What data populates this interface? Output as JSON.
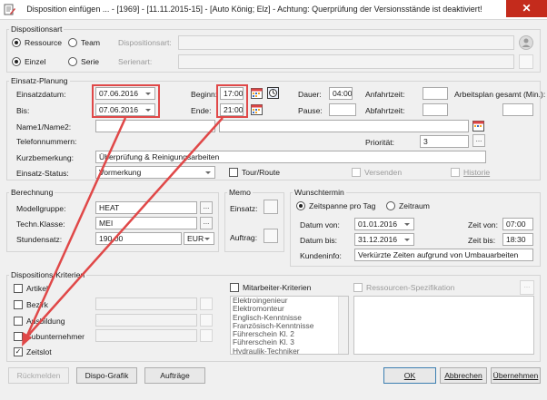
{
  "window": {
    "title": "Disposition einfügen ... - [1969] - [11.11.2015-15] - [Auto König; Elz] - Achtung: Querprüfung der Versionsstände ist deaktiviert!",
    "close_symbol": "✕"
  },
  "dispositionsart": {
    "group_label": "Dispositionsart",
    "ressource": "Ressource",
    "team": "Team",
    "einzel": "Einzel",
    "serie": "Serie",
    "dispositionsart_label": "Dispositionsart:",
    "serienart_label": "Serienart:"
  },
  "planung": {
    "group_label": "Einsatz-Planung",
    "einsatzdatum_label": "Einsatzdatum:",
    "einsatzdatum": "07.06.2016",
    "bis_label": "Bis:",
    "bis": "07.06.2016",
    "beginn_label": "Beginn:",
    "beginn": "17:00",
    "ende_label": "Ende:",
    "ende": "21:00",
    "dauer_label": "Dauer:",
    "dauer": "04:00",
    "pause_label": "Pause:",
    "pause": "",
    "anfahrt_label": "Anfahrtzeit:",
    "abfahrt_label": "Abfahrtzeit:",
    "arbeitsplan_label": "Arbeitsplan gesamt (Min.):",
    "name_label": "Name1/Name2:",
    "telefon_label": "Telefonnummern:",
    "prioritaet_label": "Priorität:",
    "prioritaet": "3",
    "kurzbemerkung_label": "Kurzbemerkung:",
    "kurzbemerkung": "Überprüfung & Reinigungsarbeiten",
    "status_label": "Einsatz-Status:",
    "status": "Vormerkung",
    "tour": "Tour/Route",
    "versenden": "Versenden",
    "historie": "Historie"
  },
  "berechnung": {
    "group_label": "Berechnung",
    "modellgruppe_label": "Modellgruppe:",
    "modellgruppe": "HEAT",
    "klasse_label": "Techn.Klasse:",
    "klasse": "MEI",
    "stundensatz_label": "Stundensatz:",
    "stundensatz": "190,00",
    "waehrung": "EUR"
  },
  "memo": {
    "group_label": "Memo",
    "einsatz_label": "Einsatz:",
    "auftrag_label": "Auftrag:"
  },
  "wunschtermin": {
    "group_label": "Wunschtermin",
    "zeitspanne": "Zeitspanne pro Tag",
    "zeitraum": "Zeitraum",
    "datum_von_label": "Datum von:",
    "datum_von": "01.01.2016",
    "datum_bis_label": "Datum bis:",
    "datum_bis": "31.12.2016",
    "zeit_von_label": "Zeit von:",
    "zeit_von": "07:00",
    "zeit_bis_label": "Zeit bis:",
    "zeit_bis": "18:30",
    "kundeninfo_label": "Kundeninfo:",
    "kundeninfo": "Verkürzte Zeiten aufgrund von Umbauarbeiten"
  },
  "kriterien": {
    "group_label": "Dispositions-Kriterien",
    "artikel": "Artikel",
    "bezirk": "Bezirk",
    "ausbildung": "Ausbildung",
    "subunternehmer": "Subunternehmer",
    "zeitslot": "Zeitslot",
    "mitarbeiter": "Mitarbeiter-Kriterien",
    "ressourcen": "Ressourcen-Spezifikation",
    "skills": [
      "Elektroingenieur",
      "Elektromonteur",
      "Englisch-Kenntnisse",
      "Französisch-Kenntnisse",
      "Führerschein Kl. 2",
      "Führerschein Kl. 3",
      "Hydraulik-Techniker"
    ]
  },
  "buttons": {
    "rueckmelden": "Rückmelden",
    "dispo_grafik": "Dispo-Grafik",
    "auftraege": "Aufträge",
    "ok": "OK",
    "abbrechen": "Abbrechen",
    "uebernehmen": "Übernehmen",
    "ellipsis": "..."
  },
  "colors": {
    "annotation": "#e04848",
    "close": "#c42b1c"
  }
}
